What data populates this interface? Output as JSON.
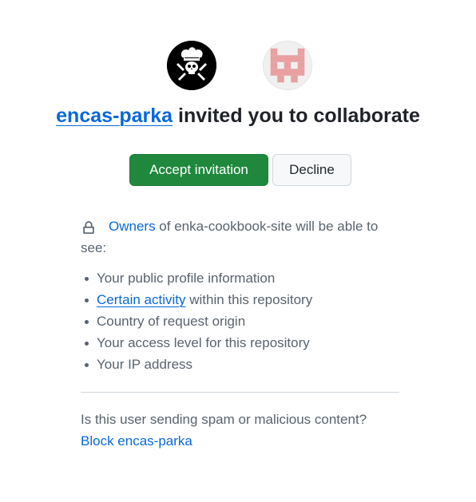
{
  "inviter": {
    "username": "encas-parka",
    "invite_suffix": " invited you to collaborate"
  },
  "actions": {
    "accept_label": "Accept invitation",
    "decline_label": "Decline"
  },
  "notice": {
    "owners_link": "Owners",
    "text": " of enka-cookbook-site will be able to see:"
  },
  "permissions": {
    "item_profile": "Your public profile information",
    "item_activity_link": "Certain activity",
    "item_activity_rest": " within this repository",
    "item_country": "Country of request origin",
    "item_access": "Your access level for this repository",
    "item_ip": "Your IP address"
  },
  "spam": {
    "question": "Is this user sending spam or malicious content?",
    "block_link": "Block encas-parka"
  },
  "colors": {
    "accent_link": "#0969da",
    "accept_green": "#1f883d",
    "identicon": "#e8a0a0"
  },
  "icons": {
    "lock": "lock-icon"
  }
}
